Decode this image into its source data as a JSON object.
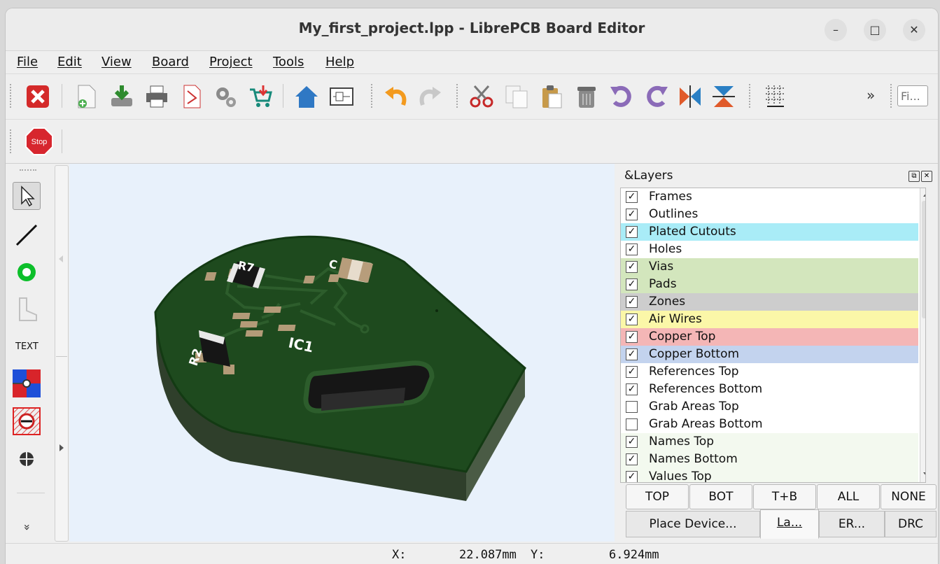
{
  "window": {
    "title": "My_first_project.lpp - LibrePCB Board Editor",
    "minimize": "–",
    "maximize": "□",
    "close": "✕"
  },
  "menu": [
    "File",
    "Edit",
    "View",
    "Board",
    "Project",
    "Tools",
    "Help"
  ],
  "toolbar": {
    "overflow": "»",
    "find_placeholder": "Fi...",
    "icons": [
      "close-project-icon",
      "new-board-icon",
      "save-icon",
      "print-icon",
      "export-pdf-icon",
      "gear-icon",
      "order-cart-icon",
      "home-icon",
      "schematic-icon",
      "undo-icon",
      "redo-icon",
      "cut-icon",
      "copy-icon",
      "paste-icon",
      "delete-icon",
      "rotate-ccw-icon",
      "rotate-cw-icon",
      "mirror-icon",
      "flip-icon",
      "grid-icon"
    ]
  },
  "toolbar2": {
    "stop_label": "Stop"
  },
  "tools": {
    "text_label": "TEXT",
    "expand": "»"
  },
  "board": {
    "labels": {
      "r7": "R7",
      "c": "C",
      "r2": "R2",
      "ic1": "IC1"
    }
  },
  "layers_dock": {
    "title": "&Layers",
    "layers": [
      {
        "name": "Frames",
        "checked": true,
        "color": "#ffffff"
      },
      {
        "name": "Outlines",
        "checked": true,
        "color": "#ffffff"
      },
      {
        "name": "Plated Cutouts",
        "checked": true,
        "color": "#a9ecf7"
      },
      {
        "name": "Holes",
        "checked": true,
        "color": "#ffffff"
      },
      {
        "name": "Vias",
        "checked": true,
        "color": "#d3e6bd"
      },
      {
        "name": "Pads",
        "checked": true,
        "color": "#d3e6bd"
      },
      {
        "name": "Zones",
        "checked": true,
        "color": "#cdcdcd"
      },
      {
        "name": "Air Wires",
        "checked": true,
        "color": "#fbf7a8"
      },
      {
        "name": "Copper Top",
        "checked": true,
        "color": "#f4b6b6"
      },
      {
        "name": "Copper Bottom",
        "checked": true,
        "color": "#c3d3ee"
      },
      {
        "name": "References Top",
        "checked": true,
        "color": "#ffffff"
      },
      {
        "name": "References Bottom",
        "checked": true,
        "color": "#ffffff"
      },
      {
        "name": "Grab Areas Top",
        "checked": false,
        "color": "#ffffff"
      },
      {
        "name": "Grab Areas Bottom",
        "checked": false,
        "color": "#ffffff"
      },
      {
        "name": "Names Top",
        "checked": true,
        "color": "#f3f9ef"
      },
      {
        "name": "Names Bottom",
        "checked": true,
        "color": "#f3f9ef"
      },
      {
        "name": "Values Top",
        "checked": true,
        "color": "#f3f9ef"
      }
    ],
    "check_mark": "✓",
    "buttons": [
      "TOP",
      "BOT",
      "T+B",
      "ALL",
      "NONE"
    ],
    "tabs": [
      "Place Device...",
      "La...",
      "ER...",
      "DRC"
    ]
  },
  "status": {
    "x_label": "X:",
    "x_value": "22.087mm",
    "y_label": "Y:",
    "y_value": "6.924mm"
  }
}
